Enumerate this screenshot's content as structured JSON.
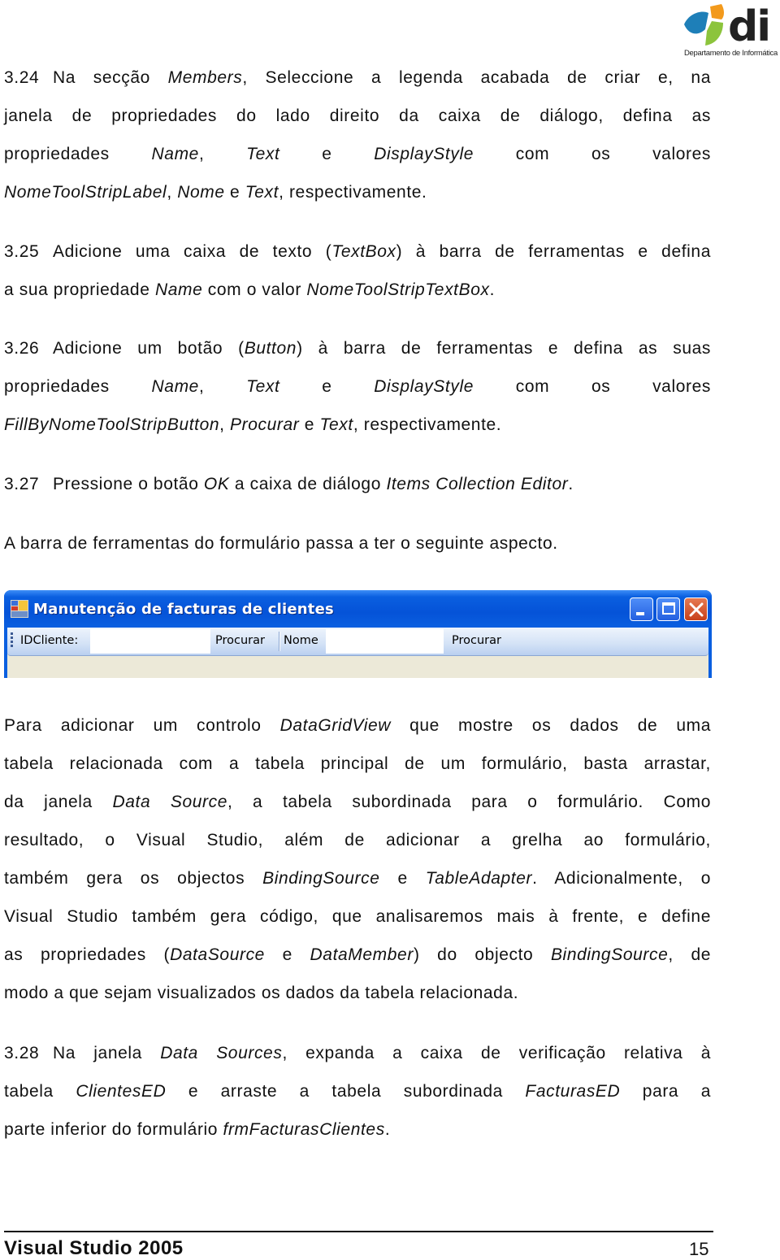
{
  "logo": {
    "text": "di",
    "caption": "Departamento de Informática",
    "colors": {
      "blue": "#1e7fb8",
      "orange": "#f39a1c",
      "green": "#8cc43c",
      "text": "#222222"
    }
  },
  "steps": {
    "s324": {
      "number": "3.24",
      "lines": [
        [
          {
            "t": "Na secção "
          },
          {
            "t": "Members",
            "i": true
          },
          {
            "t": ", Seleccione a legenda acabada de criar e, na"
          }
        ],
        [
          {
            "t": "janela de propriedades do lado direito da caixa de diálogo, defina as"
          }
        ],
        [
          {
            "t": "propriedades "
          },
          {
            "t": "Name",
            "i": true
          },
          {
            "t": ", "
          },
          {
            "t": "Text",
            "i": true
          },
          {
            "t": " e "
          },
          {
            "t": "DisplayStyle",
            "i": true
          },
          {
            "t": " com os valores"
          }
        ],
        [
          {
            "t": "NomeToolStripLabel",
            "i": true
          },
          {
            "t": ", "
          },
          {
            "t": "Nome",
            "i": true
          },
          {
            "t": " e "
          },
          {
            "t": "Text",
            "i": true
          },
          {
            "t": ", respectivamente."
          }
        ]
      ]
    },
    "s325": {
      "number": "3.25",
      "lines": [
        [
          {
            "t": "Adicione uma caixa de texto ("
          },
          {
            "t": "TextBox",
            "i": true
          },
          {
            "t": ") à barra de ferramentas e defina"
          }
        ],
        [
          {
            "t": "a sua propriedade "
          },
          {
            "t": "Name",
            "i": true
          },
          {
            "t": " com o valor "
          },
          {
            "t": "NomeToolStripTextBox",
            "i": true
          },
          {
            "t": "."
          }
        ]
      ]
    },
    "s326": {
      "number": "3.26",
      "lines": [
        [
          {
            "t": "Adicione um botão ("
          },
          {
            "t": "Button",
            "i": true
          },
          {
            "t": ") à barra de ferramentas e defina as suas"
          }
        ],
        [
          {
            "t": "propriedades "
          },
          {
            "t": "Name",
            "i": true
          },
          {
            "t": ", "
          },
          {
            "t": "Text",
            "i": true
          },
          {
            "t": " e "
          },
          {
            "t": "DisplayStyle",
            "i": true
          },
          {
            "t": " com os valores"
          }
        ],
        [
          {
            "t": "FillByNomeToolStripButton",
            "i": true
          },
          {
            "t": ", "
          },
          {
            "t": "Procurar",
            "i": true
          },
          {
            "t": " e "
          },
          {
            "t": "Text",
            "i": true
          },
          {
            "t": ", respectivamente."
          }
        ]
      ]
    },
    "s327": {
      "number": "3.27",
      "lines": [
        [
          {
            "t": "Pressione o botão "
          },
          {
            "t": "OK",
            "i": true
          },
          {
            "t": " a caixa de diálogo "
          },
          {
            "t": "Items Collection Editor",
            "i": true
          },
          {
            "t": "."
          }
        ]
      ]
    },
    "s328": {
      "number": "3.28",
      "lines": [
        [
          {
            "t": "Na janela "
          },
          {
            "t": "Data Sources",
            "i": true
          },
          {
            "t": ", expanda a caixa de verificação relativa à"
          }
        ],
        [
          {
            "t": "tabela "
          },
          {
            "t": "ClientesED",
            "i": true
          },
          {
            "t": " e arraste a tabela subordinada "
          },
          {
            "t": "FacturasED",
            "i": true
          },
          {
            "t": " para a"
          }
        ],
        [
          {
            "t": "parte inferior do formulário "
          },
          {
            "t": "frmFacturasClientes",
            "i": true
          },
          {
            "t": "."
          }
        ]
      ]
    }
  },
  "intro_toolbar": {
    "lines": [
      [
        {
          "t": "A barra de ferramentas do formulário passa a ter o seguinte aspecto."
        }
      ]
    ]
  },
  "paragraph_datagrid": {
    "lines": [
      [
        {
          "t": "Para adicionar um controlo "
        },
        {
          "t": "DataGridView",
          "i": true
        },
        {
          "t": " que mostre os dados de uma"
        }
      ],
      [
        {
          "t": "tabela relacionada com a tabela principal de um formulário, basta arrastar,"
        }
      ],
      [
        {
          "t": "da janela "
        },
        {
          "t": "Data Source",
          "i": true
        },
        {
          "t": ", a tabela subordinada para o formulário. Como"
        }
      ],
      [
        {
          "t": "resultado, o Visual Studio, além de adicionar a grelha ao formulário,"
        }
      ],
      [
        {
          "t": "também gera os objectos "
        },
        {
          "t": "BindingSource",
          "i": true
        },
        {
          "t": " e "
        },
        {
          "t": "TableAdapter",
          "i": true
        },
        {
          "t": ". Adicionalmente, o"
        }
      ],
      [
        {
          "t": "Visual Studio também gera código, que analisaremos mais à frente, e define"
        }
      ],
      [
        {
          "t": "as propriedades ("
        },
        {
          "t": "DataSource",
          "i": true
        },
        {
          "t": " e "
        },
        {
          "t": "DataMember",
          "i": true
        },
        {
          "t": ") do objecto "
        },
        {
          "t": "BindingSource",
          "i": true
        },
        {
          "t": ", de"
        }
      ],
      [
        {
          "t": "modo a que sejam visualizados os dados da tabela relacionada."
        }
      ]
    ]
  },
  "screenshot_window": {
    "title": "Manutenção de facturas de clientes",
    "buttons": {
      "minimize": "minimize",
      "maximize": "maximize",
      "close": "close"
    },
    "toolbar": {
      "id_label": "IDCliente:",
      "id_value": "",
      "procurar_1": "Procurar",
      "nome_label": "Nome",
      "nome_value": "",
      "procurar_2": "Procurar"
    },
    "colors": {
      "titlebar": "#0a5fe0",
      "close": "#d4532a",
      "client": "#ece9d8"
    }
  },
  "footer": {
    "title": "Visual Studio 2005",
    "page": "15"
  }
}
